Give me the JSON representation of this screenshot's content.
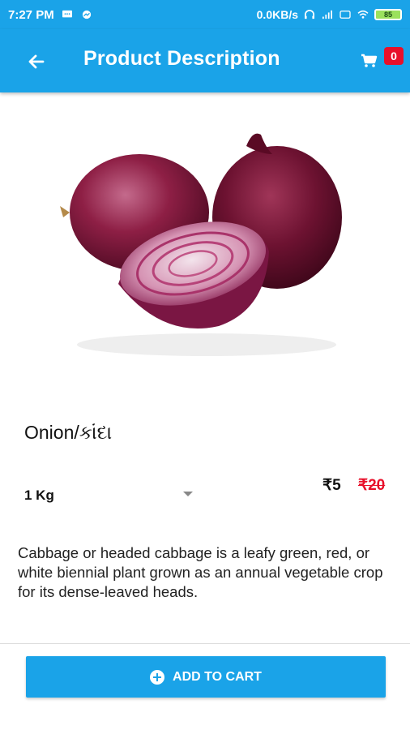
{
  "status_bar": {
    "time": "7:27 PM",
    "network_speed": "0.0KB/s",
    "battery": "85",
    "icons": [
      "chat-icon",
      "messenger-icon",
      "headset-icon",
      "signal-icon",
      "volte-icon",
      "wifi-icon",
      "battery-icon"
    ]
  },
  "app_bar": {
    "title": "Product Description",
    "back_icon": "arrow-left-icon",
    "cart_icon": "cart-icon",
    "cart_count": "0"
  },
  "product": {
    "name": "Onion/કાંદા",
    "image_alt": "onion-image",
    "variant": "1 Kg",
    "price": "₹5",
    "original_price": "₹20",
    "description": "Cabbage or headed cabbage is a leafy green, red, or white biennial plant grown as an annual vegetable crop for its dense-leaved heads."
  },
  "actions": {
    "add_to_cart_label": "ADD TO CART"
  },
  "colors": {
    "primary": "#1aa3e8",
    "accent_red": "#e8102a"
  }
}
